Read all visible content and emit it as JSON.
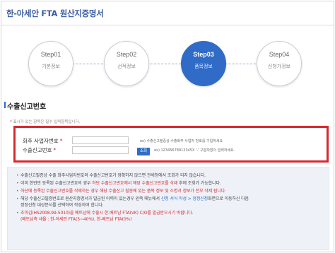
{
  "header": {
    "title": "한-아세안 FTA 원산지증명서"
  },
  "steps": [
    {
      "num": "Step01",
      "label": "기본정보"
    },
    {
      "num": "Step02",
      "label": "선적정보"
    },
    {
      "num": "Step03",
      "label": "품목정보"
    },
    {
      "num": "Step04",
      "label": "신청가정보"
    }
  ],
  "active_step": 3,
  "section": {
    "title": "수출신고번호"
  },
  "legend": {
    "star": "*",
    "text": "표시가 있는 항목은 필수 입력항목입니다."
  },
  "form": {
    "exporter_label": "화주 사업자번호",
    "declaration_label": "수출신고번호",
    "required_mark": "*",
    "exporter_value": "",
    "declaration_value": "",
    "exporter_hint": "ex) 수출신고필증상 수출화주 사업자 번호를 기입하세요",
    "declaration_hint": "ex) 12345678912345X '-' 구분자없이 입력하세요.",
    "search_label": "조회"
  },
  "notice": {
    "line1": "수출신고필증상 수출 화주사업자번호와 수출신고번호가 정확하지 않으면 관세청에서 조회가 되지 않습니다.",
    "line2_pre": "이미 한번만 등록된 수출신고번호의 경우 ",
    "line2_red": "하단 수출신고번호에서 해당 수출신고번호를 삭제",
    "line2_post": " 후에 조회가 가능합니다.",
    "line3": "하단에 등록된 수출신고번호를 삭제하는 경우 해당 수출신고 필증에 있는 품목 정보 및 소명서 정보가 전부 삭제 됩니다.",
    "line4_pre": "해당 수출신고필증번호로 원산지증명서가 발급된 이력이 있는경우 왼쪽 메뉴에서 ",
    "line4_blue": "신청 서식 작성 > 정정신청",
    "line4_post": "화면으로 이동하신 다음",
    "line4_sub": "정정신청 대상문서를 선택하여 작성하여 합니다.",
    "line5": "조미김(HS2008.99-5010)을 베트남에 수출시 한-베트남 FTA(VK) C/O를 발급받으시기 바랍니다.",
    "line5_sub": "(베트남측 세율 : 한-아세안 FTA(5~40%), 한-베트남 FTA(0%)"
  },
  "colors": {
    "accent": "#2f6bc7",
    "highlight": "#d9272e",
    "title": "#3d5fa6"
  }
}
